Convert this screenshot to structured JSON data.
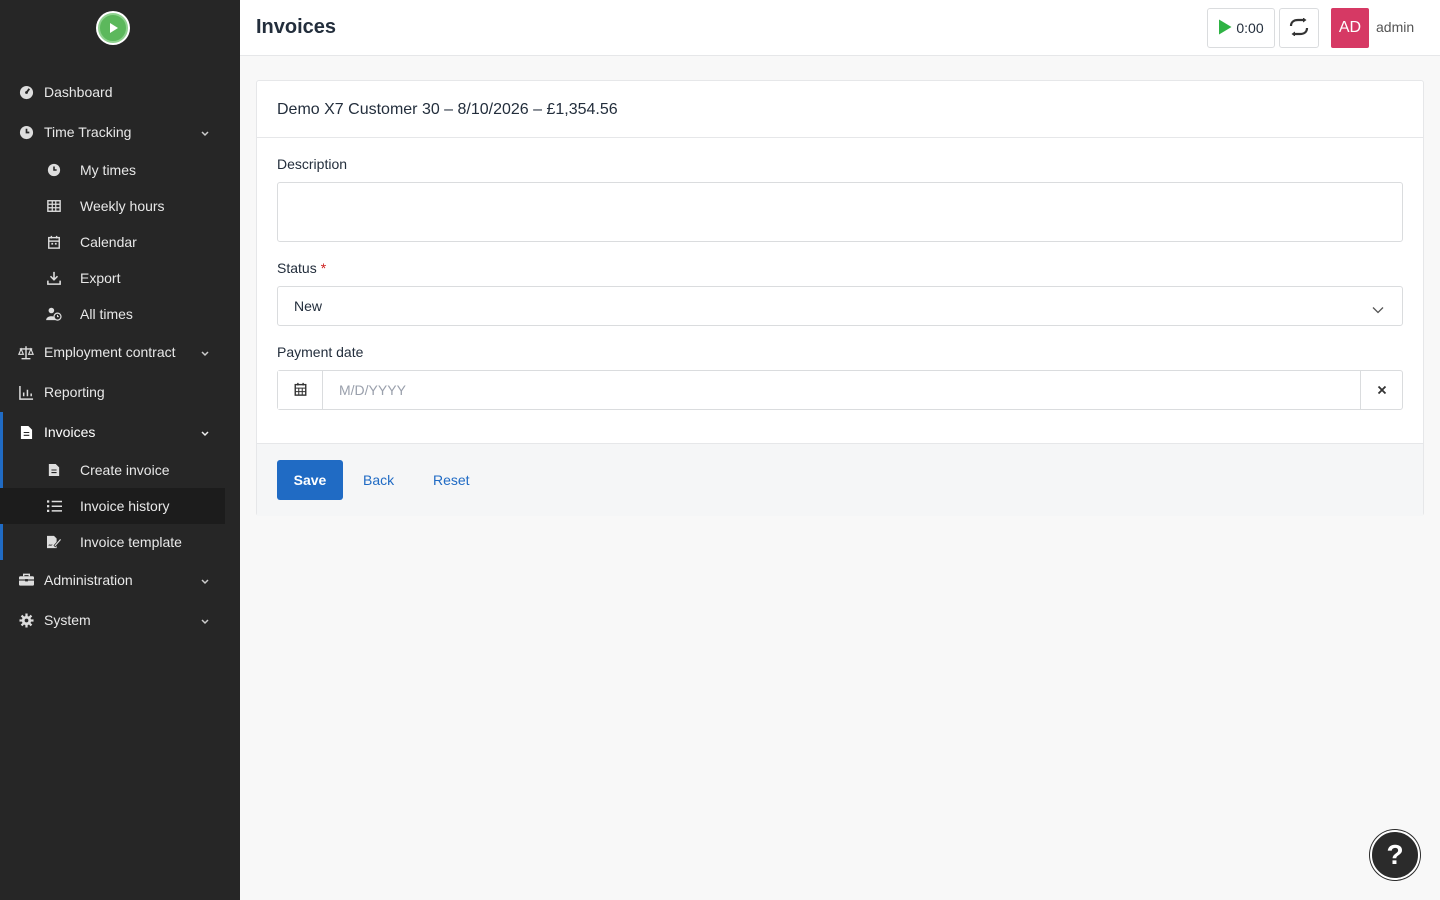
{
  "header": {
    "title": "Invoices",
    "timer": "0:00",
    "avatar_initials": "AD",
    "username": "admin"
  },
  "sidebar": {
    "items": [
      {
        "label": "Dashboard",
        "icon": "dashboard-icon"
      },
      {
        "label": "Time Tracking",
        "icon": "clock-icon",
        "expandable": true
      },
      {
        "label": "My times",
        "icon": "clock-icon"
      },
      {
        "label": "Weekly hours",
        "icon": "table-icon"
      },
      {
        "label": "Calendar",
        "icon": "calendar-icon"
      },
      {
        "label": "Export",
        "icon": "download-icon"
      },
      {
        "label": "All times",
        "icon": "user-clock-icon"
      },
      {
        "label": "Employment contract",
        "icon": "balance-scale-icon",
        "expandable": true
      },
      {
        "label": "Reporting",
        "icon": "chart-icon"
      },
      {
        "label": "Invoices",
        "icon": "file-invoice-icon",
        "expandable": true
      },
      {
        "label": "Create invoice",
        "icon": "file-invoice-icon"
      },
      {
        "label": "Invoice history",
        "icon": "list-icon",
        "active": true
      },
      {
        "label": "Invoice template",
        "icon": "file-signature-icon"
      },
      {
        "label": "Administration",
        "icon": "toolbox-icon",
        "expandable": true
      },
      {
        "label": "System",
        "icon": "gear-icon",
        "expandable": true
      }
    ]
  },
  "form": {
    "heading": "Demo X7 Customer 30 – 8/10/2026 – £1,354.56",
    "description_label": "Description",
    "description_value": "",
    "status_label": "Status",
    "status_required": "*",
    "status_value": "New",
    "payment_date_label": "Payment date",
    "payment_date_placeholder": "M/D/YYYY",
    "save_label": "Save",
    "back_label": "Back",
    "reset_label": "Reset"
  },
  "help": "?",
  "colors": {
    "primary": "#206bc4",
    "sidebar_bg": "#262626",
    "avatar_bg": "#d63964",
    "play_green": "#2fb344"
  }
}
